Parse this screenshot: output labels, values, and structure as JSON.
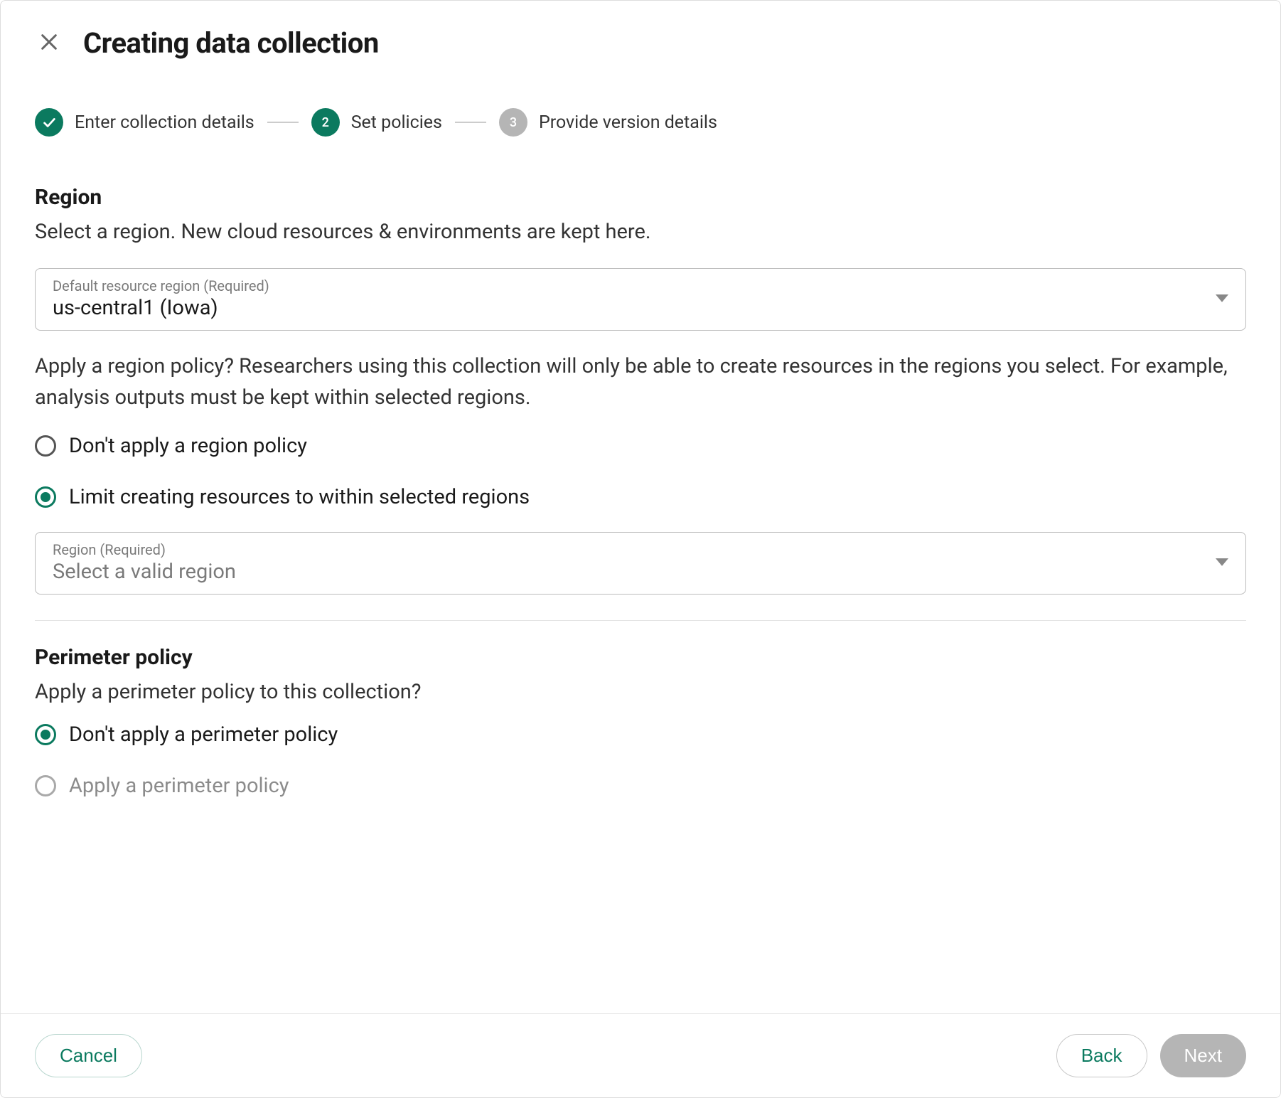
{
  "header": {
    "title": "Creating data collection"
  },
  "stepper": {
    "steps": [
      {
        "label": "Enter collection details",
        "state": "done"
      },
      {
        "label": "Set policies",
        "state": "active",
        "num": "2"
      },
      {
        "label": "Provide version details",
        "state": "pending",
        "num": "3"
      }
    ]
  },
  "region": {
    "title": "Region",
    "description": "Select a region. New cloud resources & environments are kept here.",
    "default_select": {
      "label": "Default resource region (Required)",
      "value": "us-central1 (Iowa)"
    },
    "policy_question": "Apply a region policy? Researchers using this collection will only be able to create resources in the regions you select. For example, analysis outputs must be kept within selected regions.",
    "options": {
      "none": "Don't apply a region policy",
      "limit": "Limit creating resources to within selected regions"
    },
    "selected": "limit",
    "region_select": {
      "label": "Region (Required)",
      "placeholder": "Select a valid region"
    }
  },
  "perimeter": {
    "title": "Perimeter policy",
    "description": "Apply a perimeter policy to this collection?",
    "options": {
      "none": "Don't apply a perimeter policy",
      "apply": "Apply a perimeter policy"
    },
    "selected": "none"
  },
  "footer": {
    "cancel": "Cancel",
    "back": "Back",
    "next": "Next"
  }
}
